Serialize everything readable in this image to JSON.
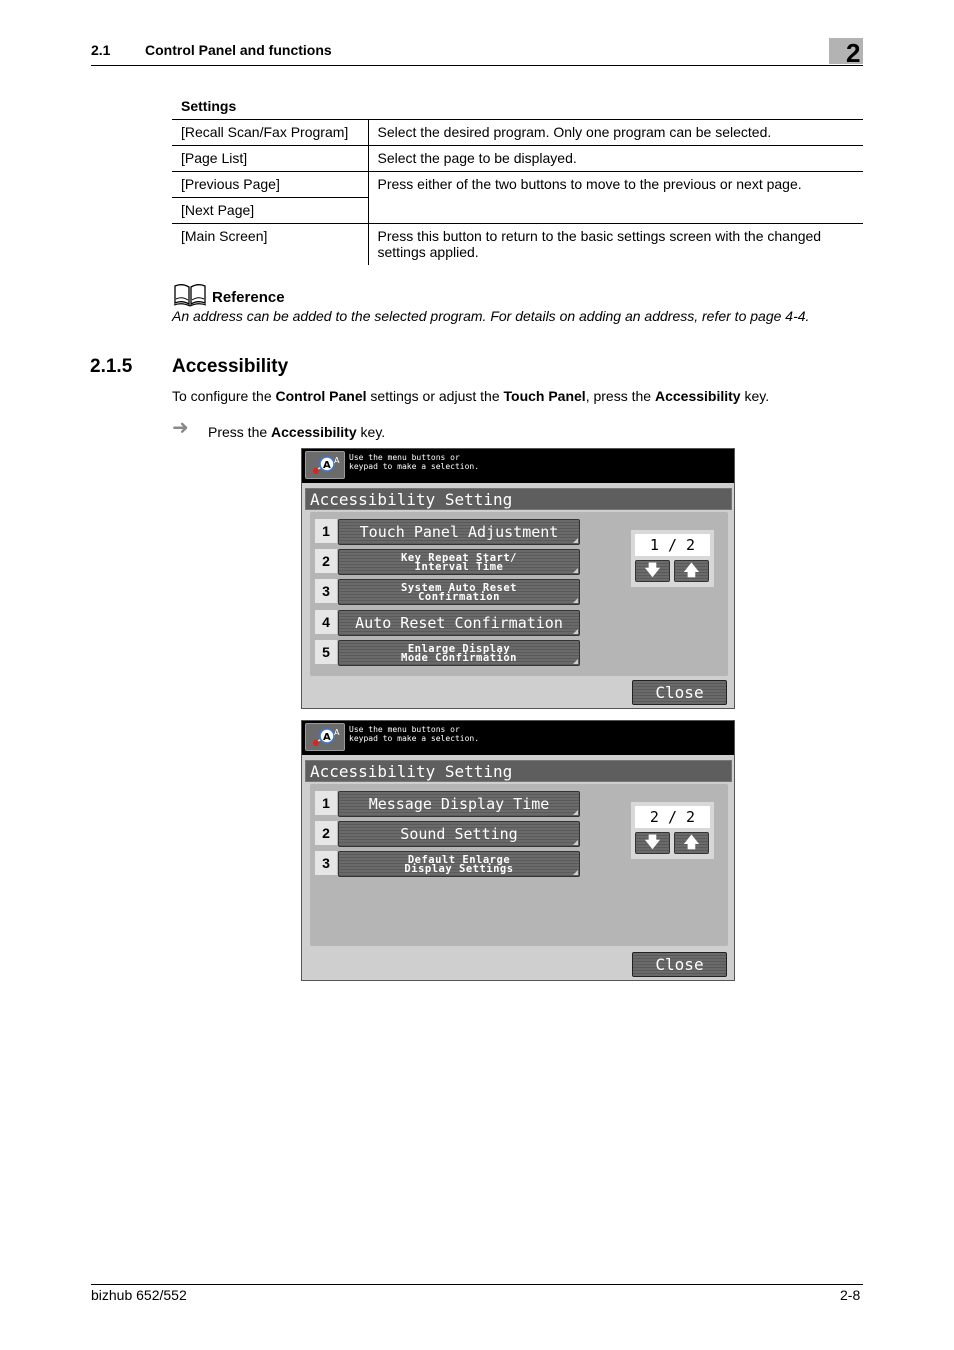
{
  "header": {
    "section_number": "2.1",
    "section_title": "Control Panel and functions",
    "chapter_number": "2"
  },
  "settings": {
    "heading": "Settings",
    "rows": [
      {
        "name": "[Recall Scan/Fax Program]",
        "description": "Select the desired program. Only one program can be selected."
      },
      {
        "name": "[Page List]",
        "description": "Select the page to be displayed."
      },
      {
        "name": "[Previous Page]",
        "description": "Press either of the two buttons to move to the previous or next page."
      },
      {
        "name": "[Next Page]",
        "description": ""
      },
      {
        "name": "[Main Screen]",
        "description": "Press this button to return to the basic settings screen with the changed settings applied."
      }
    ]
  },
  "reference": {
    "icon": "book-icon",
    "title": "Reference",
    "text": "An address can be added to the selected program. For details on adding an address, refer to page 4-4."
  },
  "section": {
    "number": "2.1.5",
    "title": "Accessibility",
    "intro": {
      "parts": [
        {
          "text": "To configure the ",
          "bold": false
        },
        {
          "text": "Control Panel",
          "bold": true
        },
        {
          "text": " settings or adjust the ",
          "bold": false
        },
        {
          "text": "Touch Panel",
          "bold": true
        },
        {
          "text": ", press the ",
          "bold": false
        },
        {
          "text": "Accessibility",
          "bold": true
        },
        {
          "text": " key.",
          "bold": false
        }
      ]
    },
    "step": {
      "icon": "arrow-right-icon",
      "prefix": "Press the ",
      "key": "Accessibility",
      "suffix": " key."
    }
  },
  "screens": [
    {
      "message_line1": "Use the menu buttons or",
      "message_line2": "keypad to make a selection.",
      "title": "Accessibility Setting",
      "page_indicator": "1 / 2",
      "page_down_icon": "arrow-down-icon",
      "page_up_icon": "arrow-up-icon",
      "close_label": "Close",
      "items": [
        {
          "number": "1",
          "line1": "Touch Panel Adjustment",
          "line2": ""
        },
        {
          "number": "2",
          "line1": "Key Repeat Start/",
          "line2": "Interval Time"
        },
        {
          "number": "3",
          "line1": "System Auto Reset",
          "line2": "Confirmation"
        },
        {
          "number": "4",
          "line1": "Auto Reset Confirmation",
          "line2": ""
        },
        {
          "number": "5",
          "line1": "Enlarge Display",
          "line2": "Mode Confirmation"
        }
      ]
    },
    {
      "message_line1": "Use the menu buttons or",
      "message_line2": "keypad to make a selection.",
      "title": "Accessibility Setting",
      "page_indicator": "2 / 2",
      "page_down_icon": "arrow-down-icon",
      "page_up_icon": "arrow-up-icon",
      "close_label": "Close",
      "items": [
        {
          "number": "1",
          "line1": "Message Display Time",
          "line2": ""
        },
        {
          "number": "2",
          "line1": "Sound Setting",
          "line2": ""
        },
        {
          "number": "3",
          "line1": "Default Enlarge",
          "line2": "Display Settings"
        }
      ]
    }
  ],
  "footer": {
    "model": "bizhub 652/552",
    "page": "2-8"
  }
}
